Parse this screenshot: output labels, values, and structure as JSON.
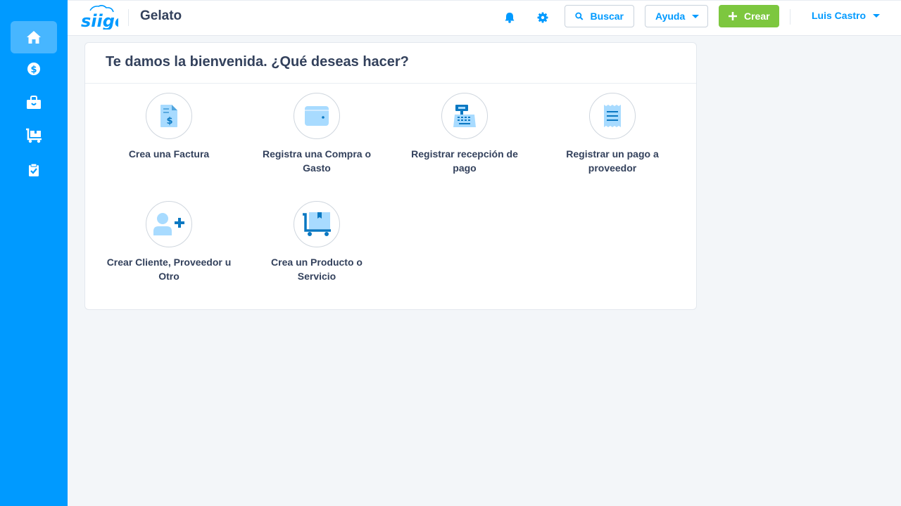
{
  "header": {
    "logo_text": "Siigo",
    "company": "Gelato",
    "search_label": "Buscar",
    "help_label": "Ayuda",
    "create_label": "Crear",
    "user_name": "Luis Castro"
  },
  "sidebar": {
    "items": [
      {
        "icon": "home-icon",
        "active": true
      },
      {
        "icon": "dollar-icon",
        "active": false
      },
      {
        "icon": "shopping-bag-icon",
        "active": false
      },
      {
        "icon": "inventory-cart-icon",
        "active": false
      },
      {
        "icon": "clipboard-check-icon",
        "active": false
      }
    ]
  },
  "welcome": {
    "title": "Te damos la bienvenida. ¿Qué deseas hacer?",
    "actions": [
      {
        "label": "Crea una Factura",
        "icon": "invoice-icon"
      },
      {
        "label": "Registra una Compra o Gasto",
        "icon": "wallet-icon"
      },
      {
        "label": "Registrar recepción de pago",
        "icon": "cash-register-icon"
      },
      {
        "label": "Registrar un pago a proveedor",
        "icon": "receipt-icon"
      },
      {
        "label": "Crear Cliente, Proveedor u Otro",
        "icon": "add-user-icon"
      },
      {
        "label": "Crea un Producto o Servicio",
        "icon": "product-cart-icon"
      }
    ]
  },
  "colors": {
    "primary": "#009aff",
    "sidebar": "#009aff",
    "create_button": "#7dc73f",
    "text": "#33415c",
    "background": "#f3f6f9",
    "icon_light": "#a8dbff",
    "icon_dark": "#0a78c2"
  }
}
